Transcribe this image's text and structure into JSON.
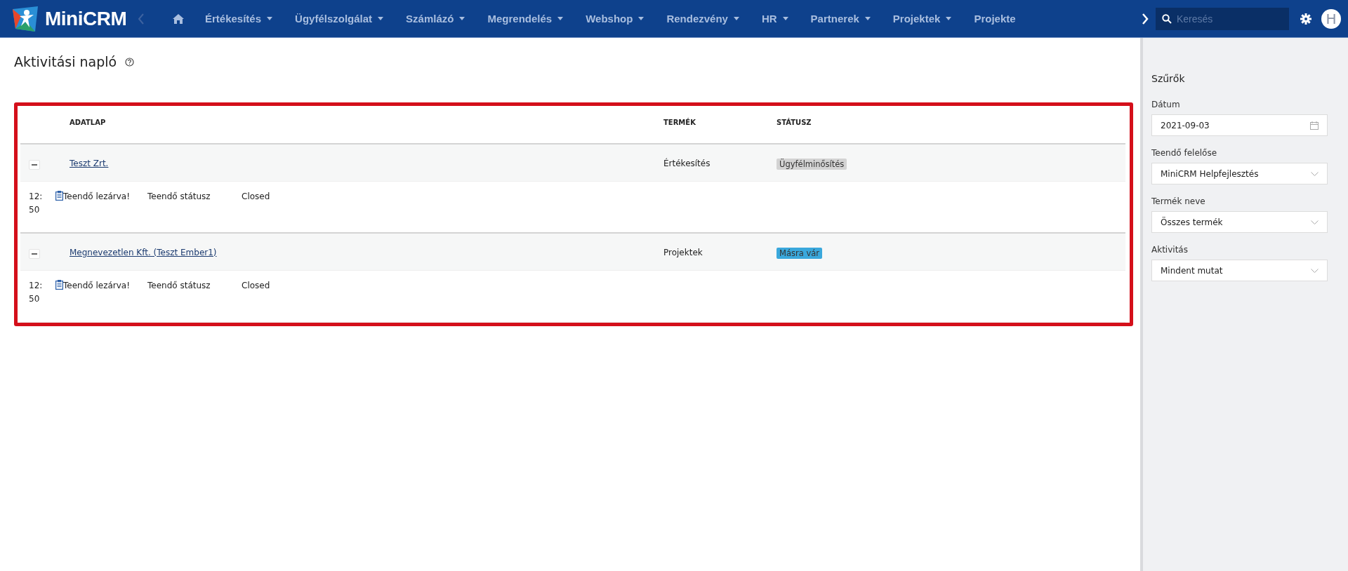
{
  "navbar": {
    "brand": "MiniCRM",
    "menu": [
      {
        "label": "Értékesítés",
        "dropdown": true
      },
      {
        "label": "Ügyfélszolgálat",
        "dropdown": true
      },
      {
        "label": "Számlázó",
        "dropdown": true
      },
      {
        "label": "Megrendelés",
        "dropdown": true
      },
      {
        "label": "Webshop",
        "dropdown": true
      },
      {
        "label": "Rendezvény",
        "dropdown": true
      },
      {
        "label": "HR",
        "dropdown": true
      },
      {
        "label": "Partnerek",
        "dropdown": true
      },
      {
        "label": "Projektek",
        "dropdown": true
      },
      {
        "label": "Projekte",
        "dropdown": false
      }
    ],
    "search": {
      "placeholder": "Keresés"
    },
    "avatar": "H"
  },
  "page": {
    "title": "Aktivitási napló"
  },
  "table": {
    "columns": [
      "ADATLAP",
      "TERMÉK",
      "STÁTUSZ"
    ],
    "groups": [
      {
        "record": "Teszt Zrt.",
        "product": "Értékesítés",
        "status": "Ügyfélminősítés",
        "color": "#d3d3d3",
        "expanded": true,
        "entries": [
          {
            "time": "12:50",
            "activity": "Teendő lezárva!",
            "field": "Teendő státusz",
            "value": "Closed"
          }
        ]
      },
      {
        "record": "Megnevezetlen Kft. (Teszt Ember1)",
        "product": "Projektek",
        "status": "Másra vár",
        "color": "#3aa8dc",
        "expanded": true,
        "entries": [
          {
            "time": "12:50",
            "activity": "Teendő lezárva!",
            "field": "Teendő státusz",
            "value": "Closed"
          }
        ]
      }
    ]
  },
  "filters": {
    "title": "Szűrők",
    "fields": [
      {
        "label": "Dátum",
        "value": "2021-09-03",
        "kind": "date"
      },
      {
        "label": "Teendő felelőse",
        "value": "MiniCRM Helpfejlesztés",
        "kind": "select"
      },
      {
        "label": "Termék neve",
        "value": "Összes termék",
        "kind": "select"
      },
      {
        "label": "Aktivitás",
        "value": "Mindent mutat",
        "kind": "select"
      }
    ]
  }
}
